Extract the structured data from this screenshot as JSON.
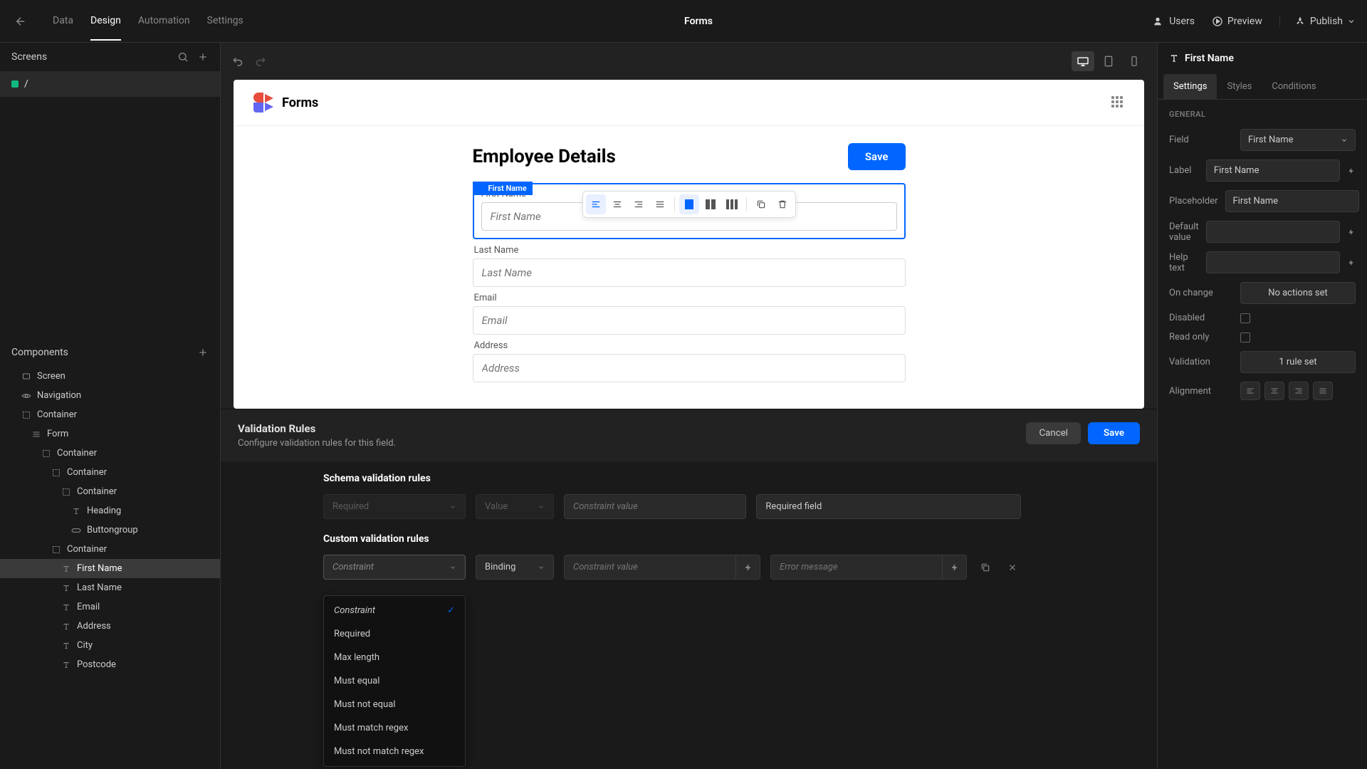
{
  "topbar": {
    "tabs": [
      "Data",
      "Design",
      "Automation",
      "Settings"
    ],
    "active_tab": "Design",
    "title": "Forms",
    "users": "Users",
    "preview": "Preview",
    "publish": "Publish"
  },
  "left": {
    "screens_label": "Screens",
    "screen_name": "/",
    "components_label": "Components",
    "tree": [
      {
        "label": "Screen",
        "icon": "screen",
        "indent": 1
      },
      {
        "label": "Navigation",
        "icon": "nav",
        "indent": 1
      },
      {
        "label": "Container",
        "icon": "container",
        "indent": 1
      },
      {
        "label": "Form",
        "icon": "form",
        "indent": 2
      },
      {
        "label": "Container",
        "icon": "container",
        "indent": 3
      },
      {
        "label": "Container",
        "icon": "container",
        "indent": 4
      },
      {
        "label": "Container",
        "icon": "container",
        "indent": 5
      },
      {
        "label": "Heading",
        "icon": "text",
        "indent": 6
      },
      {
        "label": "Buttongroup",
        "icon": "btngrp",
        "indent": 6
      },
      {
        "label": "Container",
        "icon": "container",
        "indent": 4
      },
      {
        "label": "First Name",
        "icon": "text",
        "indent": 5,
        "selected": true
      },
      {
        "label": "Last Name",
        "icon": "text",
        "indent": 5
      },
      {
        "label": "Email",
        "icon": "text",
        "indent": 5
      },
      {
        "label": "Address",
        "icon": "text",
        "indent": 5
      },
      {
        "label": "City",
        "icon": "text",
        "indent": 5
      },
      {
        "label": "Postcode",
        "icon": "text",
        "indent": 5
      }
    ]
  },
  "canvas": {
    "app_title": "Forms",
    "heading": "Employee Details",
    "save": "Save",
    "selected_badge": "First Name",
    "fields": [
      {
        "label": "First Name",
        "placeholder": "First Name",
        "selected": true
      },
      {
        "label": "Last Name",
        "placeholder": "Last Name"
      },
      {
        "label": "Email",
        "placeholder": "Email"
      },
      {
        "label": "Address",
        "placeholder": "Address"
      }
    ]
  },
  "validation": {
    "title": "Validation Rules",
    "subtitle": "Configure validation rules for this field.",
    "cancel": "Cancel",
    "save": "Save",
    "schema_title": "Schema validation rules",
    "schema_row": {
      "constraint": "Required",
      "value": "Value",
      "constraint_value_ph": "Constraint value",
      "error_value": "Required field"
    },
    "custom_title": "Custom validation rules",
    "custom_row": {
      "constraint_ph": "Constraint",
      "binding": "Binding",
      "constraint_value_ph": "Constraint value",
      "error_ph": "Error message"
    },
    "dropdown": [
      "Constraint",
      "Required",
      "Max length",
      "Must equal",
      "Must not equal",
      "Must match regex",
      "Must not match regex"
    ],
    "dropdown_selected": "Constraint"
  },
  "right": {
    "header": "First Name",
    "tabs": [
      "Settings",
      "Styles",
      "Conditions"
    ],
    "active_tab": "Settings",
    "section": "GENERAL",
    "rows": {
      "field_label": "Field",
      "field_value": "First Name",
      "label_label": "Label",
      "label_value": "First Name",
      "placeholder_label": "Placeholder",
      "placeholder_value": "First Name",
      "default_label": "Default value",
      "default_value": "",
      "help_label": "Help text",
      "help_value": "",
      "onchange_label": "On change",
      "onchange_value": "No actions set",
      "disabled_label": "Disabled",
      "readonly_label": "Read only",
      "validation_label": "Validation",
      "validation_value": "1 rule set",
      "alignment_label": "Alignment"
    }
  }
}
